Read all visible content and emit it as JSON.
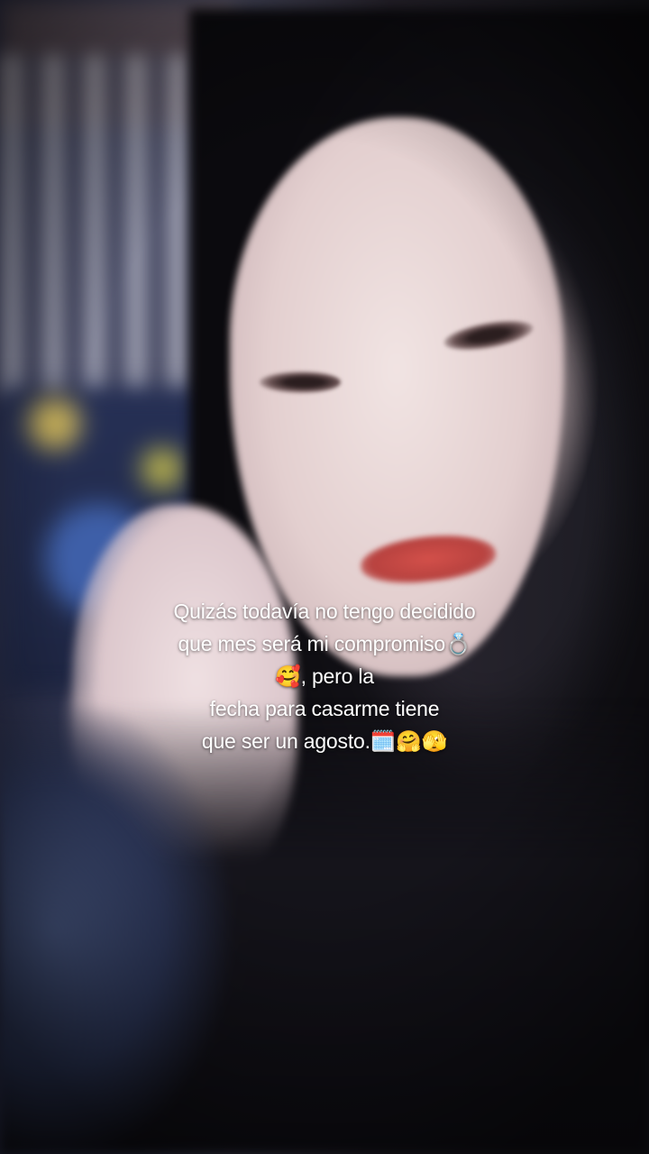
{
  "caption": {
    "line1": "Quizás todavía no tengo decidido",
    "line2": "que mes será mi compromiso💍",
    "line3": "🥰, pero la",
    "line4": "fecha para casarme tiene",
    "line5": "que ser un agosto.🗓️🤗🫣"
  }
}
